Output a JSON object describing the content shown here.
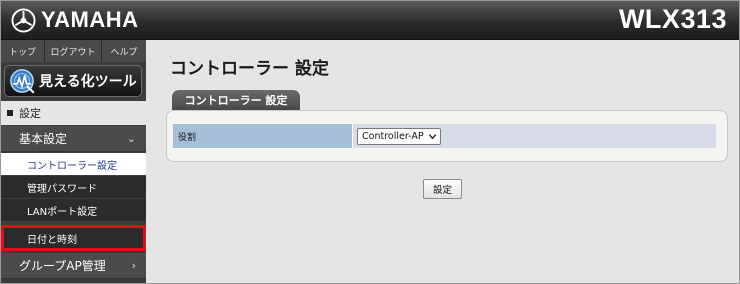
{
  "header": {
    "brand_name": "YAMAHA",
    "model": "WLX313"
  },
  "sidebar": {
    "top_links": [
      "トップ",
      "ログアウト",
      "ヘルプ"
    ],
    "viz_tool_label": "見える化ツール",
    "section_label": "設定",
    "groups": [
      {
        "label": "基本設定",
        "expanded": true,
        "items": [
          {
            "label": "コントローラー設定",
            "active": true,
            "highlighted": false
          },
          {
            "label": "管理パスワード",
            "active": false,
            "highlighted": false
          },
          {
            "label": "LANポート設定",
            "active": false,
            "highlighted": false
          },
          {
            "label": "日付と時刻",
            "active": false,
            "highlighted": true
          }
        ]
      },
      {
        "label": "グループAP管理",
        "expanded": false
      }
    ]
  },
  "main": {
    "page_title": "コントローラー 設定",
    "tab_label": "コントローラー 設定",
    "form": {
      "row_label": "役割",
      "select_value": "Controller-AP"
    },
    "submit_label": "設定"
  },
  "colors": {
    "highlight_border": "#e0101a",
    "active_item_text": "#1c3a8a",
    "form_label_bg": "#a6bed8"
  }
}
